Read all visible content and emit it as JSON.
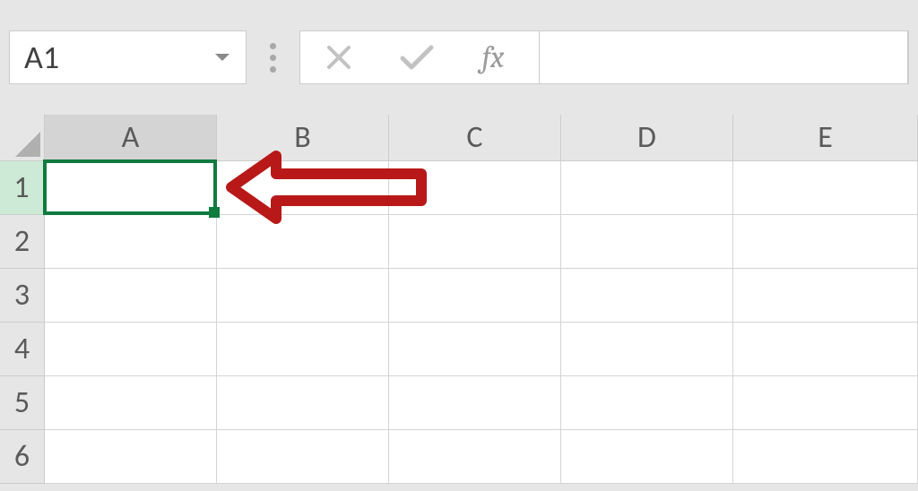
{
  "nameBox": {
    "value": "A1"
  },
  "formulaBar": {
    "cancelAria": "Cancel",
    "enterAria": "Enter",
    "fxLabel": "fx",
    "value": ""
  },
  "columns": [
    "A",
    "B",
    "C",
    "D",
    "E"
  ],
  "rows": [
    "1",
    "2",
    "3",
    "4",
    "5",
    "6"
  ],
  "activeCell": {
    "col": "A",
    "row": "1"
  }
}
